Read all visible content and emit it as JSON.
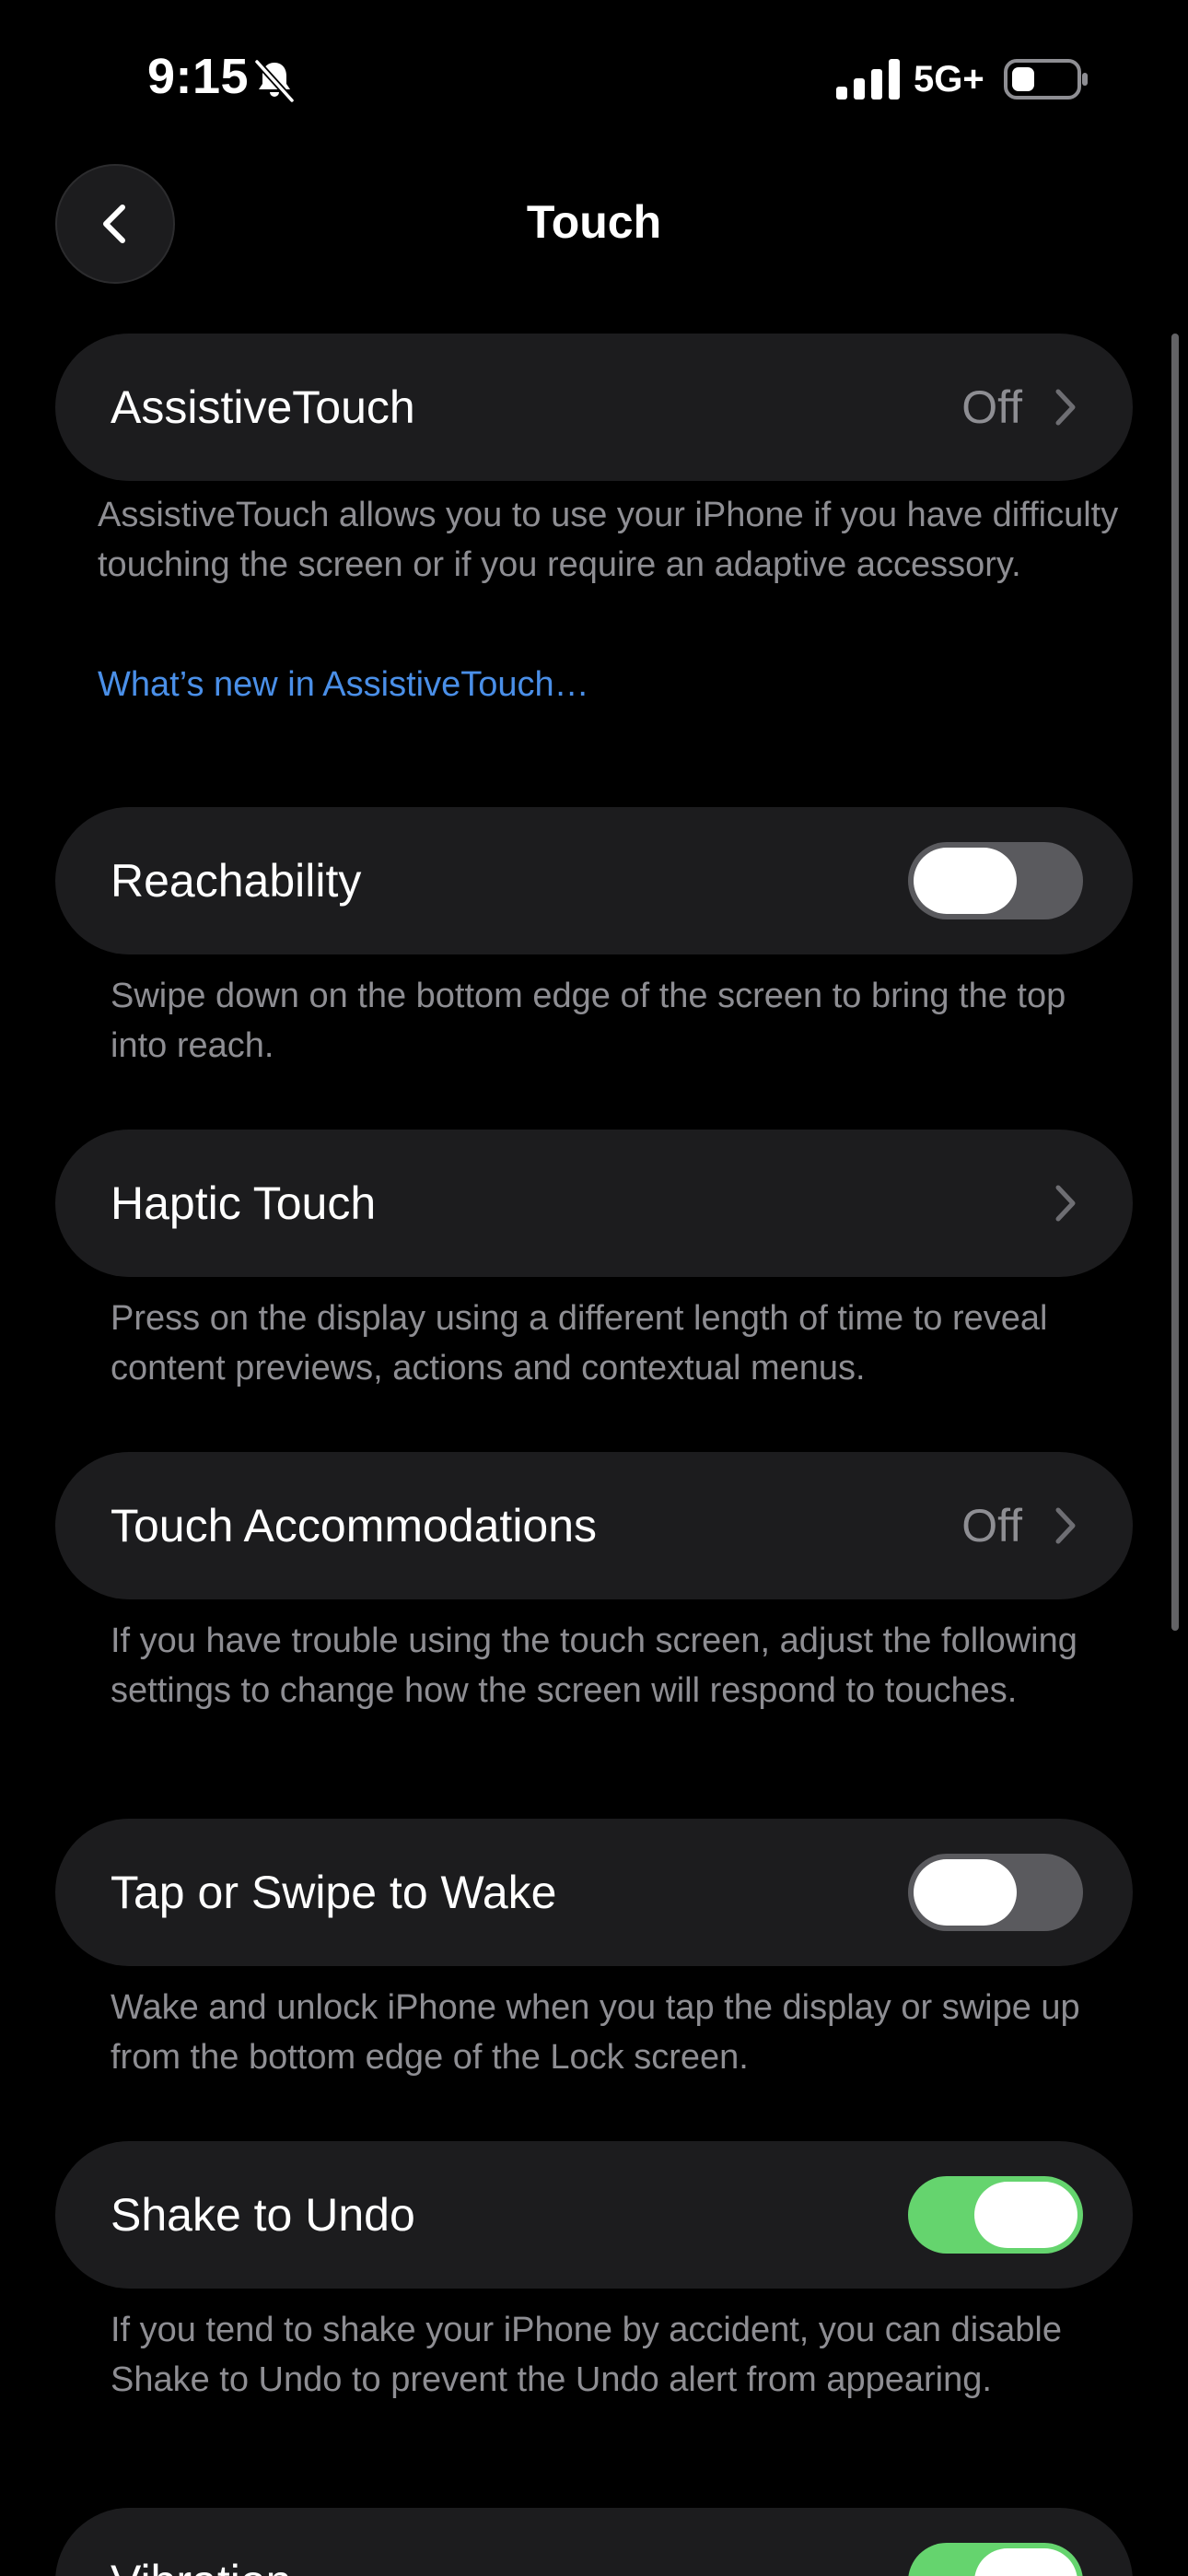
{
  "status_bar": {
    "time": "9:15",
    "network": "5G+",
    "icons": [
      "bell-slash-icon",
      "cellular-signal-icon",
      "battery-icon"
    ]
  },
  "nav": {
    "title": "Touch",
    "back_icon": "chevron-left-icon"
  },
  "colors": {
    "background": "#000000",
    "row_background": "#1c1c1e",
    "secondary_text": "#8e8e93",
    "link": "#4a8fe8",
    "toggle_on": "#65d46e",
    "toggle_off": "#5a5a5e"
  },
  "sections": [
    {
      "label": "AssistiveTouch",
      "value": "Off",
      "control": "chevron",
      "footer": "AssistiveTouch allows you to use your iPhone if you have difficulty touching the screen or if you require an adaptive accessory.",
      "link": "What’s new in AssistiveTouch…"
    },
    {
      "label": "Reachability",
      "control": "toggle",
      "toggle_on": false,
      "footer": "Swipe down on the bottom edge of the screen to bring the top into reach."
    },
    {
      "label": "Haptic Touch",
      "control": "chevron",
      "footer": "Press on the display using a different length of time to reveal content previews, actions and contextual menus."
    },
    {
      "label": "Touch Accommodations",
      "value": "Off",
      "control": "chevron",
      "footer": "If you have trouble using the touch screen, adjust the following settings to change how the screen will respond to touches."
    },
    {
      "label": "Tap or Swipe to Wake",
      "control": "toggle",
      "toggle_on": false,
      "footer": "Wake and unlock iPhone when you tap the display or swipe up from the bottom edge of the Lock screen."
    },
    {
      "label": "Shake to Undo",
      "control": "toggle",
      "toggle_on": true,
      "footer": "If you tend to shake your iPhone by accident, you can disable Shake to Undo to prevent the Undo alert from appearing."
    },
    {
      "label": "Vibration",
      "control": "toggle",
      "toggle_on": true
    }
  ]
}
